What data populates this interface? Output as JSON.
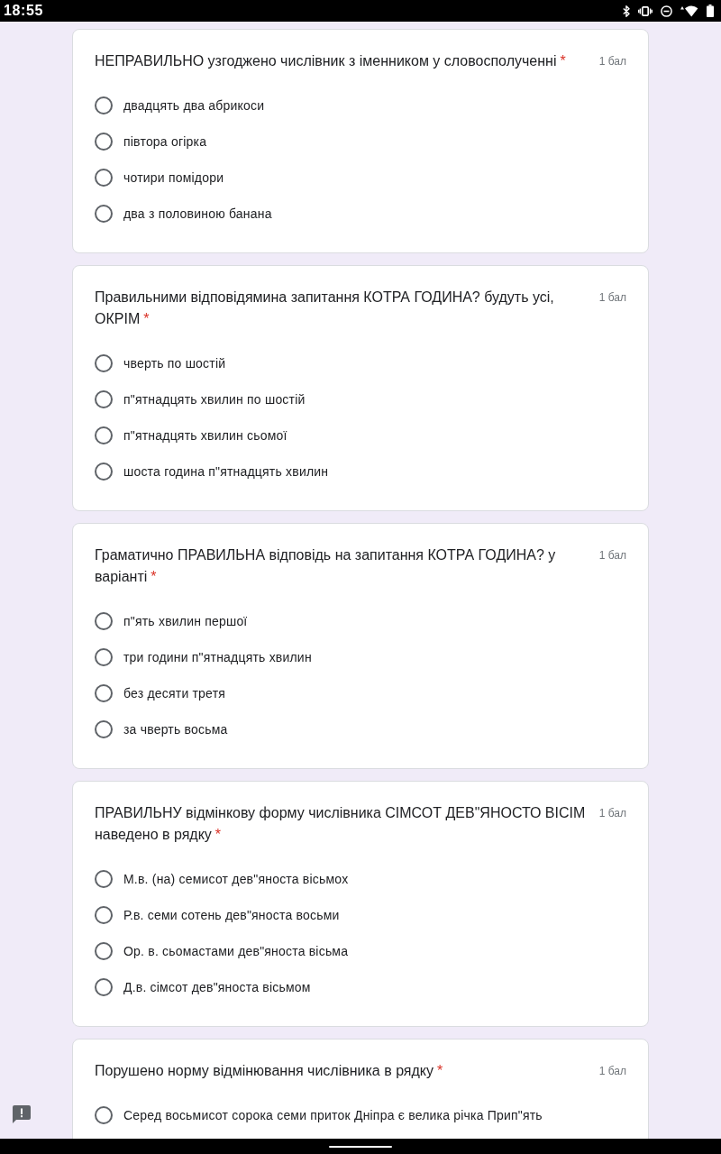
{
  "status_bar": {
    "time": "18:55"
  },
  "questions": [
    {
      "title": "НЕПРАВИЛЬНО узгоджено числівник з іменником у словосполученні",
      "required_mark": "*",
      "points": "1 бал",
      "options": [
        {
          "label": "двадцять два абрикоси",
          "selected": false
        },
        {
          "label": "півтора огірка",
          "selected": false
        },
        {
          "label": "чотири помідори",
          "selected": false
        },
        {
          "label": "два з половиною банана",
          "selected": false
        }
      ]
    },
    {
      "title": "Правильними відповідямина запитання КОТРА ГОДИНА? будуть усі, ОКРІМ",
      "required_mark": "*",
      "points": "1 бал",
      "options": [
        {
          "label": "чверть по шостій",
          "selected": false
        },
        {
          "label": "п\"ятнадцять хвилин по шостій",
          "selected": false
        },
        {
          "label": "п\"ятнадцять хвилин сьомої",
          "selected": false
        },
        {
          "label": "шоста година п\"ятнадцять хвилин",
          "selected": false
        }
      ]
    },
    {
      "title": "Граматично ПРАВИЛЬНА відповідь на запитання КОТРА ГОДИНА? у варіанті",
      "required_mark": "*",
      "points": "1 бал",
      "options": [
        {
          "label": "п\"ять хвилин першої",
          "selected": false
        },
        {
          "label": "три години п\"ятнадцять хвилин",
          "selected": false
        },
        {
          "label": "без десяти третя",
          "selected": false
        },
        {
          "label": "за чверть восьма",
          "selected": false
        }
      ]
    },
    {
      "title": "ПРАВИЛЬНУ відмінкову форму числівника СІМСОТ ДЕВ\"ЯНОСТО ВІСІМ наведено в рядку",
      "required_mark": "*",
      "points": "1 бал",
      "options": [
        {
          "label": "М.в. (на) семисот дев\"яноста вісьмох",
          "selected": false
        },
        {
          "label": "Р.в. семи сотень дев\"яноста восьми",
          "selected": false
        },
        {
          "label": "Ор. в. сьомастами дев\"яноста вісьма",
          "selected": false
        },
        {
          "label": "Д.в. сімсот дев\"яноста вісьмом",
          "selected": false
        }
      ]
    },
    {
      "title": "Порушено норму відмінювання числівника в рядку",
      "required_mark": "*",
      "points": "1 бал",
      "options": [
        {
          "label": "Серед восьмисот сорока семи приток Дніпра є велика річка Прип\"ять",
          "selected": false
        }
      ]
    }
  ]
}
